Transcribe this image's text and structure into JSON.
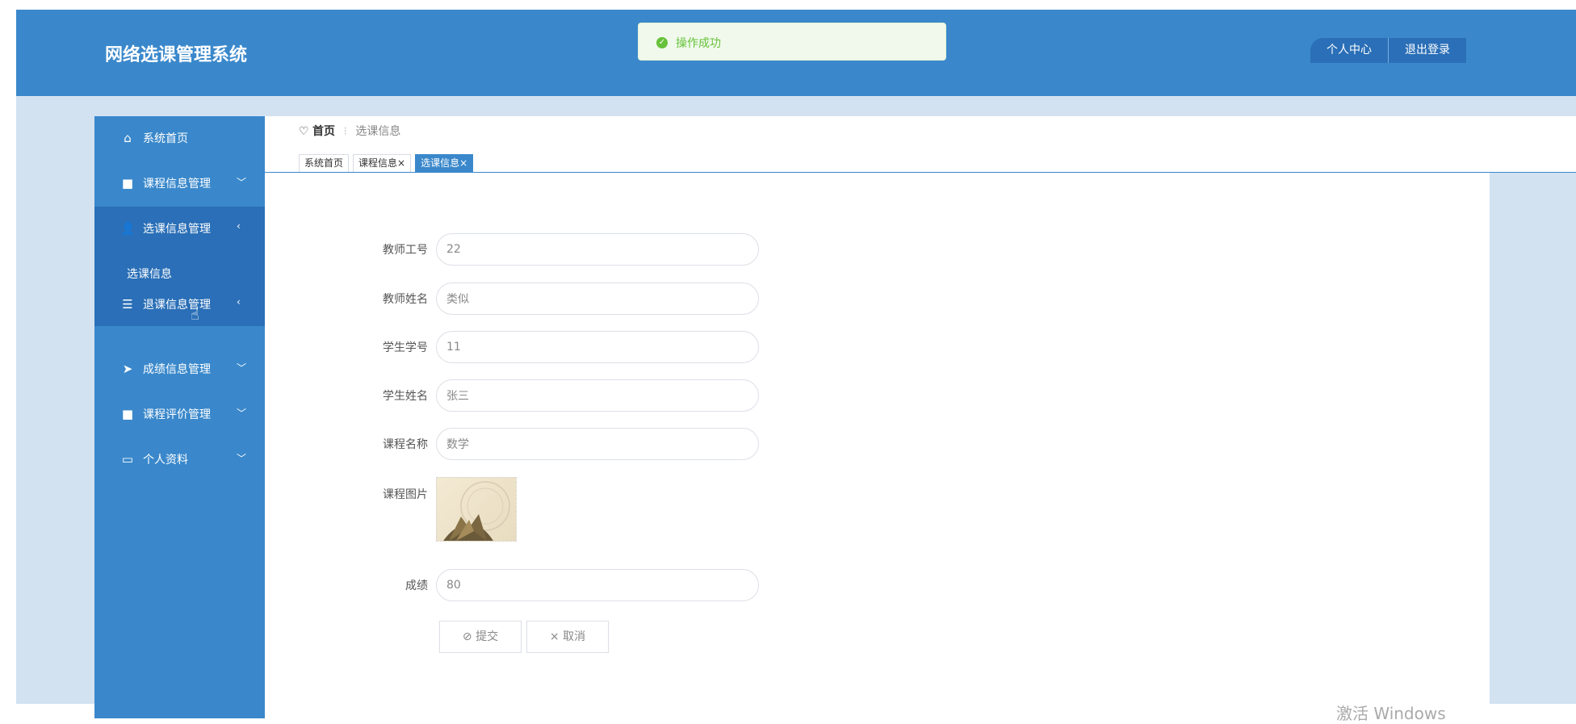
{
  "header": {
    "title": "网络选课管理系统",
    "personal_center": "个人中心",
    "logout": "退出登录"
  },
  "toast": {
    "message": "操作成功",
    "color": "#67c23a"
  },
  "sidebar": {
    "items": [
      {
        "label": "系统首页",
        "icon": "home-icon",
        "chevron": ""
      },
      {
        "label": "课程信息管理",
        "icon": "grid-icon",
        "chevron": "﹀"
      },
      {
        "label": "选课信息管理",
        "icon": "user-icon",
        "chevron": "‹"
      },
      {
        "label": "退课信息管理",
        "icon": "sliders-icon",
        "chevron": "‹"
      },
      {
        "label": "成绩信息管理",
        "icon": "send-icon",
        "chevron": "﹀"
      },
      {
        "label": "课程评价管理",
        "icon": "grid-icon",
        "chevron": "﹀"
      },
      {
        "label": "个人资料",
        "icon": "card-icon",
        "chevron": "﹀"
      }
    ],
    "submenu_item": "选课信息"
  },
  "breadcrumb": {
    "home": "首页",
    "current": "选课信息"
  },
  "tabs": [
    {
      "label": "系统首页"
    },
    {
      "label": "课程信息×"
    },
    {
      "label": "选课信息×"
    }
  ],
  "form": {
    "teacher_id": {
      "label": "教师工号",
      "value": "22"
    },
    "teacher_name": {
      "label": "教师姓名",
      "value": "类似"
    },
    "student_id": {
      "label": "学生学号",
      "value": "11"
    },
    "student_name": {
      "label": "学生姓名",
      "value": "张三"
    },
    "course_name": {
      "label": "课程名称",
      "value": "数学"
    },
    "course_image": {
      "label": "课程图片"
    },
    "score": {
      "label": "成绩",
      "value": "80"
    },
    "submit": "提交",
    "cancel": "取消"
  },
  "watermark": "激活 Windows",
  "colors": {
    "primary": "#3a88cb",
    "primary_dark": "#2a6fb7",
    "background": "#d3e2f1"
  }
}
